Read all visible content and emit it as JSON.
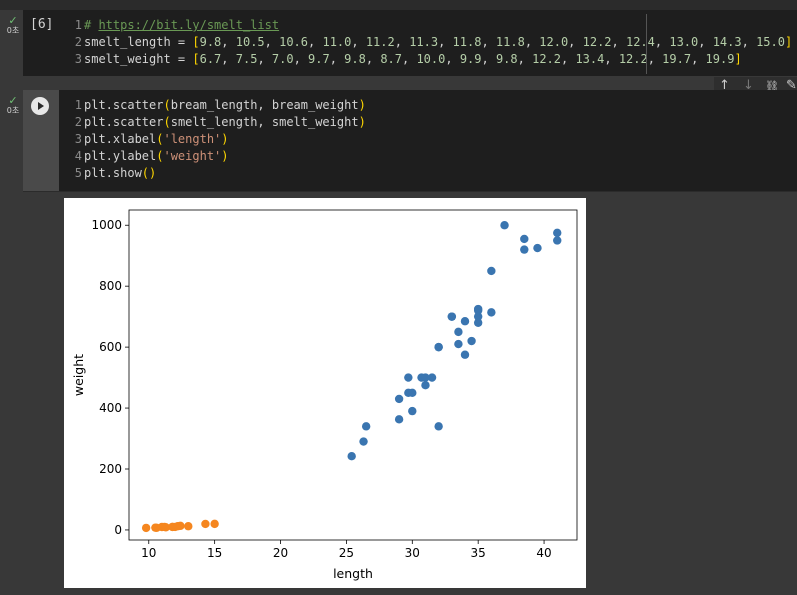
{
  "cells": [
    {
      "status_check": "✓",
      "status_time": "0초",
      "exec_count": "[6]",
      "lines": [
        {
          "n": "1",
          "text": "# https://bit.ly/smelt_list"
        },
        {
          "n": "2",
          "text": "smelt_length = [9.8, 10.5, 10.6, 11.0, 11.2, 11.3, 11.8, 11.8, 12.0, 12.2, 12.4, 13.0, 14.3, 15.0]"
        },
        {
          "n": "3",
          "text": "smelt_weight = [6.7, 7.5, 7.0, 9.7, 9.8, 8.7, 10.0, 9.9, 9.8, 12.2, 13.4, 12.2, 19.7, 19.9]"
        }
      ]
    },
    {
      "status_check": "✓",
      "status_time": "0초",
      "lines": [
        {
          "n": "1",
          "text": "plt.scatter(bream_length, bream_weight)"
        },
        {
          "n": "2",
          "text": "plt.scatter(smelt_length, smelt_weight)"
        },
        {
          "n": "3",
          "text": "plt.xlabel('length')"
        },
        {
          "n": "4",
          "text": "plt.ylabel('weight')"
        },
        {
          "n": "5",
          "text": "plt.show()"
        }
      ]
    }
  ],
  "toolbar": {
    "up_icon": "↑",
    "down_icon": "↓",
    "link_icon": "🔗",
    "edit_icon": "✎"
  },
  "colors": {
    "series_blue": "#3a75b0",
    "series_orange": "#f5861f"
  },
  "chart_data": {
    "type": "scatter",
    "xlabel": "length",
    "ylabel": "weight",
    "xlim": [
      8.5,
      42.5
    ],
    "ylim": [
      -33,
      1050
    ],
    "xticks": [
      10,
      15,
      20,
      25,
      30,
      35,
      40
    ],
    "yticks": [
      0,
      200,
      400,
      600,
      800,
      1000
    ],
    "grid": false,
    "series": [
      {
        "color": "#3a75b0",
        "x": [
          25.4,
          26.3,
          26.5,
          29.0,
          29.0,
          29.7,
          29.7,
          30.0,
          30.0,
          30.7,
          31.0,
          31.0,
          31.5,
          32.0,
          32.0,
          32.0,
          33.0,
          33.0,
          33.5,
          33.5,
          34.0,
          34.0,
          34.5,
          35.0,
          35.0,
          35.0,
          35.0,
          36.0,
          36.0,
          37.0,
          38.5,
          38.5,
          39.5,
          41.0,
          41.0
        ],
        "y": [
          242,
          290,
          340,
          363,
          430,
          450,
          500,
          390,
          450,
          500,
          475,
          500,
          500,
          340,
          600,
          600,
          700,
          700,
          610,
          650,
          575,
          685,
          620,
          680,
          700,
          725,
          720,
          714,
          850,
          1000,
          920,
          955,
          925,
          975,
          950
        ]
      },
      {
        "color": "#f5861f",
        "x": [
          9.8,
          10.5,
          10.6,
          11.0,
          11.2,
          11.3,
          11.8,
          11.8,
          12.0,
          12.2,
          12.4,
          13.0,
          14.3,
          15.0
        ],
        "y": [
          6.7,
          7.5,
          7.0,
          9.7,
          9.8,
          8.7,
          10.0,
          9.9,
          9.8,
          12.2,
          13.4,
          12.2,
          19.7,
          19.9
        ]
      }
    ]
  }
}
